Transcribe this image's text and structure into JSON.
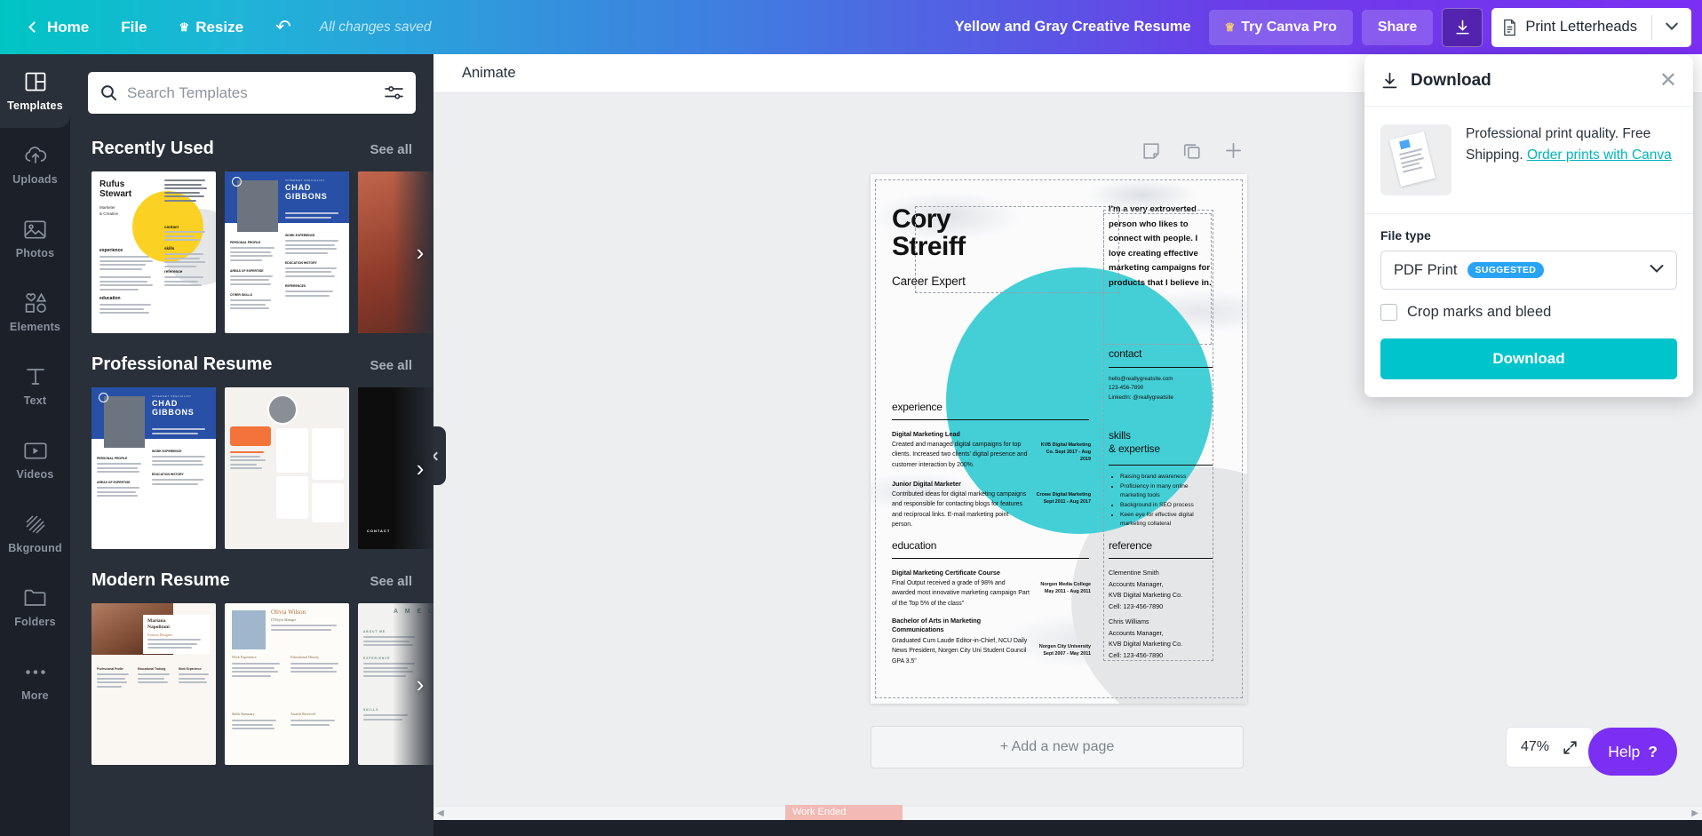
{
  "topbar": {
    "home": "Home",
    "file": "File",
    "resize": "Resize",
    "saved_status": "All changes saved",
    "doc_title": "Yellow and Gray Creative Resume",
    "try_pro": "Try Canva Pro",
    "share": "Share",
    "print_label": "Print Letterheads"
  },
  "rail": {
    "items": [
      {
        "label": "Templates",
        "icon": "templates-icon",
        "active": true
      },
      {
        "label": "Uploads",
        "icon": "upload-cloud-icon",
        "active": false
      },
      {
        "label": "Photos",
        "icon": "photo-icon",
        "active": false
      },
      {
        "label": "Elements",
        "icon": "shapes-icon",
        "active": false
      },
      {
        "label": "Text",
        "icon": "text-icon",
        "active": false
      },
      {
        "label": "Videos",
        "icon": "video-icon",
        "active": false
      },
      {
        "label": "Bkground",
        "icon": "background-icon",
        "active": false
      },
      {
        "label": "Folders",
        "icon": "folder-icon",
        "active": false
      },
      {
        "label": "More",
        "icon": "more-dots-icon",
        "active": false
      }
    ]
  },
  "panel": {
    "search_placeholder": "Search Templates",
    "search_value": "",
    "see_all": "See all",
    "sections": [
      {
        "title": "Recently Used"
      },
      {
        "title": "Professional Resume"
      },
      {
        "title": "Modern Resume"
      }
    ]
  },
  "context_toolbar": {
    "animate": "Animate"
  },
  "canvas": {
    "add_page": "+ Add a new page",
    "zoom": "47%",
    "help": "Help",
    "help_mark": "?",
    "page_tools": [
      "note-icon",
      "duplicate-page-icon",
      "add-page-icon"
    ]
  },
  "taskbar": {
    "work_ended": "Work Ended"
  },
  "resume": {
    "name_line1": "Cory",
    "name_line2": "Streiff",
    "role": "Career Expert",
    "intro": "I'm a very extroverted person who likes to connect with people. I love creating effective marketing campaigns for products that I believe in.",
    "contact_heading": "contact",
    "contact_email": "hello@reallygreatsite.com",
    "contact_phone": "123-456-7890",
    "contact_linkedin": "LinkedIn: @reallygreatsite",
    "experience_heading": "experience",
    "experience": [
      {
        "title": "Digital Marketing Lead",
        "desc": "Created and managed digital campaigns for top clients. Increased two clients' digital presence and customer interaction by 200%.",
        "meta": "KVB Digital Marketing Co. Sept 2017 - Aug 2019"
      },
      {
        "title": "Junior Digital Marketer",
        "desc": "Contributed ideas for digital marketing campaigns and responsible for contacting blogs for features and reciprocal links. E-mail marketing point person.",
        "meta": "Crowe Digital Marketing Sept 2011 - Aug 2017"
      }
    ],
    "skills_heading_1": "skills",
    "skills_heading_2": "& expertise",
    "skills": [
      "Raising brand awareness",
      "Proficiency in many online marketing tools",
      "Background in SEO process",
      "Keen eye for effective digital marketing collateral"
    ],
    "education_heading": "education",
    "education": [
      {
        "title": "Digital Marketing Certificate Course",
        "desc": "Final Output received a grade of 98% and awarded most innovative marketing campaign Part of the Top 5% of the class\"",
        "meta": "Norgen Media College May 2011 - Aug 2011"
      },
      {
        "title": "Bachelor of Arts in Marketing Communications",
        "desc": "Graduated Cum Laude Editor-in-Chief, NCU Daily News President, Norgen City Uni Student Council GPA 3.5\"",
        "meta": "Norgen City University Sept 2007 - May 2011"
      }
    ],
    "reference_heading": "reference",
    "references": [
      {
        "name": "Clementine Smith",
        "title": "Accounts Manager,",
        "company": "KVB Digital Marketing Co.",
        "cell": "Cell: 123-456-7890"
      },
      {
        "name": "Chris Williams",
        "title": "Accounts Manager,",
        "company": "KVB Digital Marketing Co.",
        "cell": "Cell: 123-456-7890"
      }
    ]
  },
  "download_panel": {
    "title": "Download",
    "promo_text": "Professional print quality. Free Shipping.",
    "promo_link": "Order prints with Canva",
    "file_type_label": "File type",
    "file_type_value": "PDF Print",
    "file_type_badge": "SUGGESTED",
    "crop_label": "Crop marks and bleed",
    "crop_checked": false,
    "download_button": "Download"
  },
  "colors": {
    "accent_teal": "#00c4cc",
    "brand_purple": "#7b2ff2",
    "panel_dark": "#2a3039",
    "rail_dark": "#1b2029",
    "badge_blue": "#29a3f5",
    "resume_teal": "#44cfd6",
    "work_ended_pink": "#f3b9b4"
  }
}
